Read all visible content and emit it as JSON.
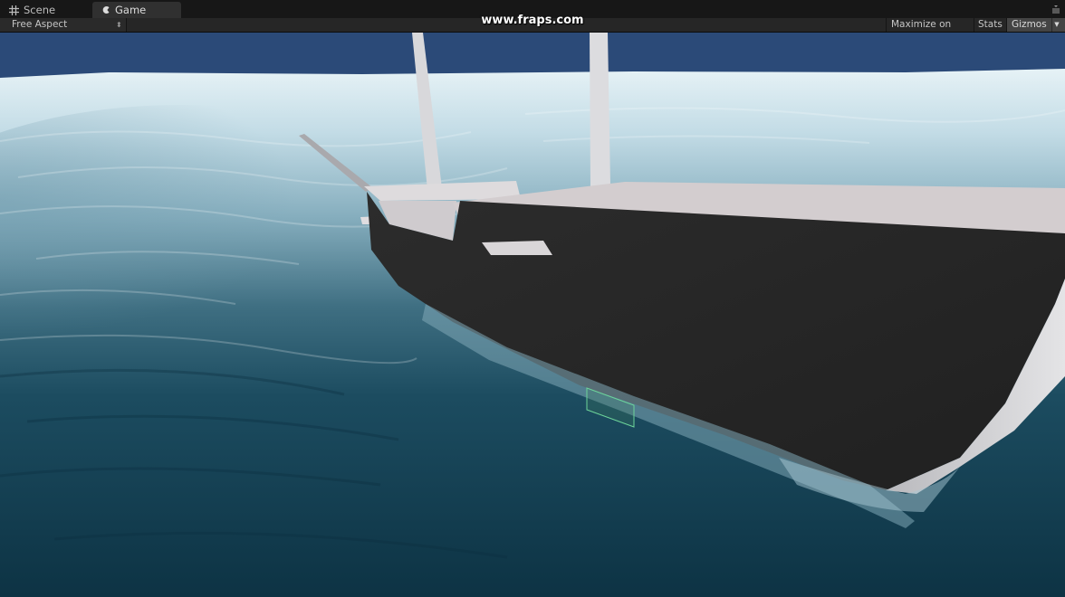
{
  "tabs": [
    {
      "label": "Scene",
      "icon": "grid-icon",
      "active": false
    },
    {
      "label": "Game",
      "icon": "game-controller-icon",
      "active": true
    }
  ],
  "overlay": {
    "watermark": "www.fraps.com"
  },
  "toolbar": {
    "aspect": "Free Aspect",
    "maximize_label": "Maximize on Play",
    "stats_label": "Stats",
    "gizmos_label": "Gizmos"
  },
  "colors": {
    "sky": "#2b4a78",
    "sea_dark": "#0f3a4c",
    "sea_light": "#cfe4ec",
    "hull": "#262626",
    "deck": "#d3cdcf"
  }
}
